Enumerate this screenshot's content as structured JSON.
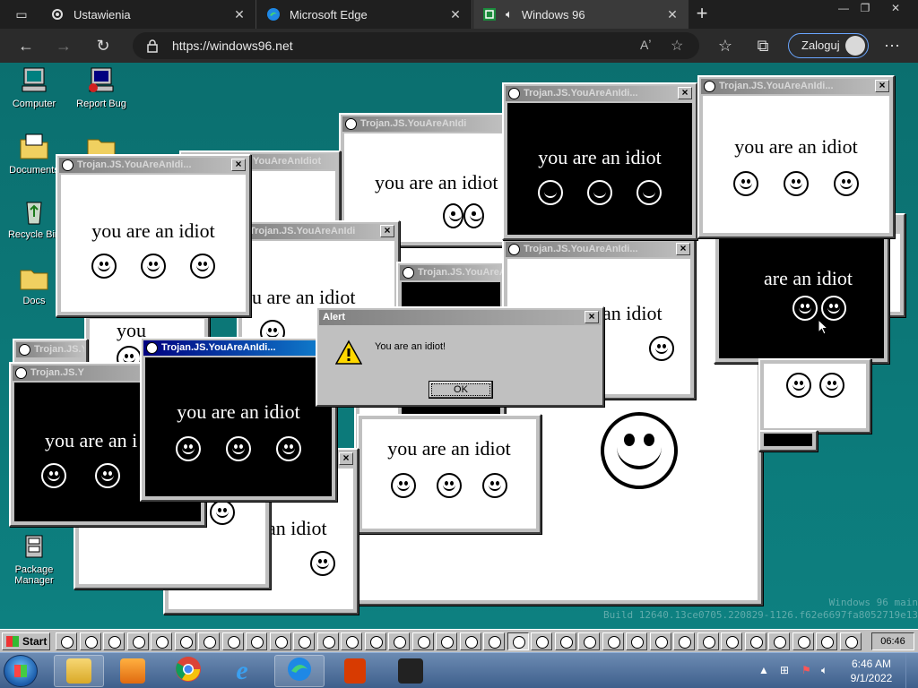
{
  "browser": {
    "tabs": [
      {
        "label": "Ustawienia",
        "icon": "gear-icon"
      },
      {
        "label": "Microsoft Edge",
        "icon": "edge-icon"
      },
      {
        "label": "Windows 96",
        "icon": "windows96-icon",
        "audio": "speaker-icon"
      }
    ],
    "url": "https://windows96.net",
    "login_label": "Zaloguj"
  },
  "desktop_icons": [
    {
      "label": "Computer"
    },
    {
      "label": "Report Bug"
    },
    {
      "label": "Documents"
    },
    {
      "label": "Recycle Bin"
    },
    {
      "label": "Docs"
    },
    {
      "label": "Package Manager"
    }
  ],
  "virus": {
    "window_title": "Trojan.JS.YouAreAnIdi...",
    "window_title_variants": [
      "Trojan.JS.YouAreAnIdi...",
      "YouAreAnIdiot",
      "Trojan.JS.YouAreAnIdi",
      "Trojan.JS.YouAreAn",
      "Trojan.JS.Y"
    ],
    "message": "you are an idiot",
    "message_fragments": [
      "are an idiot",
      "an idiot",
      "you",
      "you are an i",
      "ou are an idiot",
      "an idiot",
      "idiot"
    ]
  },
  "alert": {
    "title": "Alert",
    "text": "You are an idiot!",
    "ok_label": "OK"
  },
  "watermark": {
    "line1": "Windows 96 main",
    "line2": "Build 12640.13ce0705.220829-1126.f62e6697fa8052719e13"
  },
  "w96taskbar": {
    "start_label": "Start",
    "clock": "06:46"
  },
  "win7taskbar": {
    "time": "6:46 AM",
    "date": "9/1/2022"
  },
  "colors": {
    "desktop_teal": "#0d8080",
    "active_title": "#000080",
    "inactive_title": "#808080"
  }
}
